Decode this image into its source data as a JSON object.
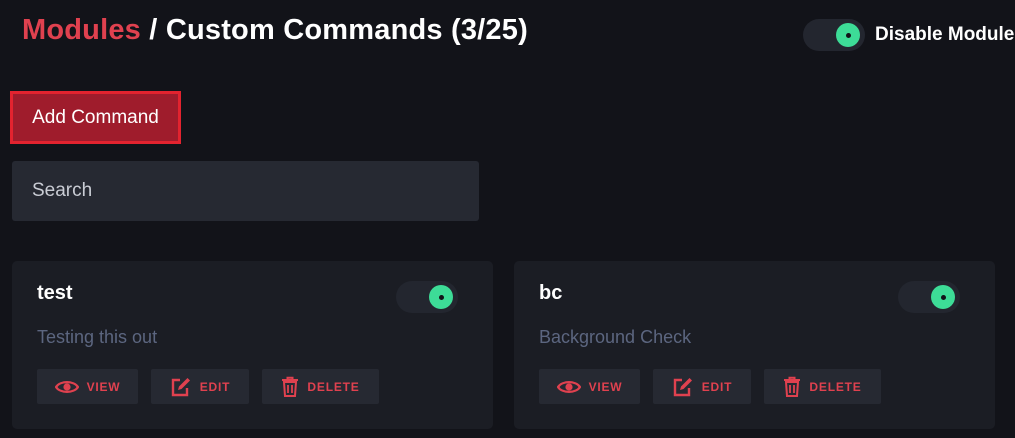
{
  "header": {
    "breadcrumb_root": "Modules",
    "breadcrumb_separator": "/",
    "breadcrumb_current": "Custom Commands (3/25)"
  },
  "module_toggle": {
    "label": "Disable Module",
    "state": "on"
  },
  "toolbar": {
    "add_label": "Add Command"
  },
  "search": {
    "placeholder": "Search",
    "value": ""
  },
  "commands": [
    {
      "name": "test",
      "description": "Testing this out",
      "enabled": true,
      "view_label": "VIEW",
      "edit_label": "EDIT",
      "delete_label": "DELETE"
    },
    {
      "name": "bc",
      "description": "Background Check",
      "enabled": true,
      "view_label": "VIEW",
      "edit_label": "EDIT",
      "delete_label": "DELETE"
    }
  ],
  "icons": {
    "view": "eye-icon",
    "edit": "edit-icon",
    "delete": "trash-icon"
  },
  "colors": {
    "accent_red": "#e0414f",
    "toggle_on": "#3ddc97",
    "background": "#121319",
    "card": "#1b1d24",
    "button_bg": "#262932",
    "muted_text": "#5c6680"
  }
}
